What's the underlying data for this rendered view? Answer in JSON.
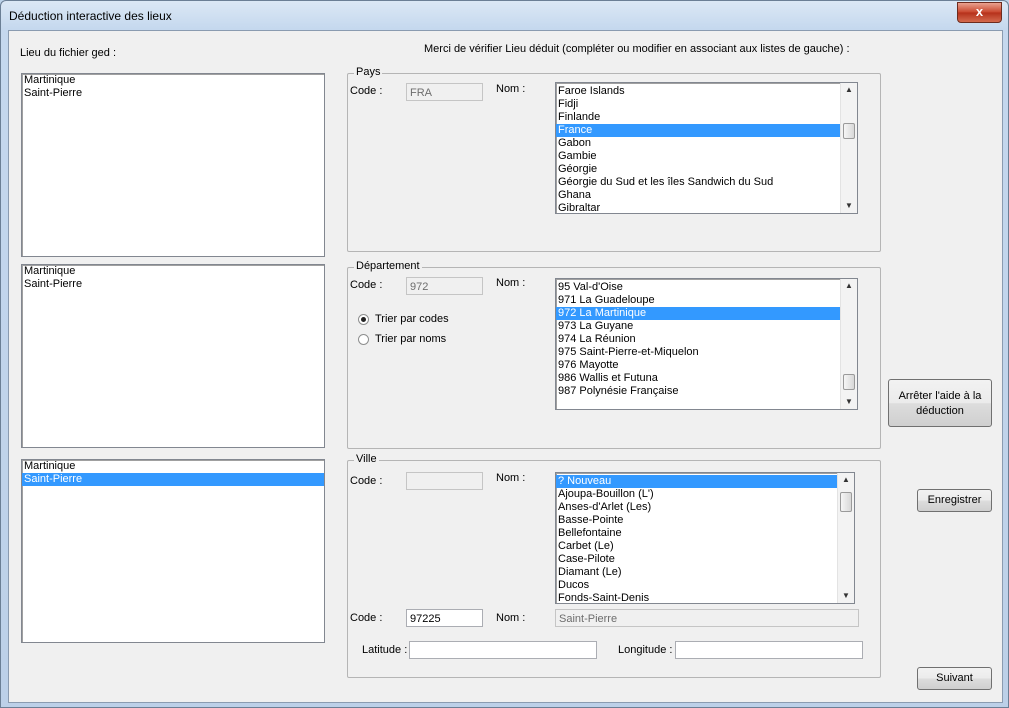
{
  "window": {
    "title": "Déduction interactive des lieux",
    "close_glyph": "x"
  },
  "left": {
    "heading": "Lieu du fichier ged :",
    "lists": [
      [
        "Martinique",
        "Saint-Pierre"
      ],
      [
        "Martinique",
        "Saint-Pierre"
      ],
      [
        "Martinique",
        "Saint-Pierre"
      ]
    ],
    "selected_third": "Saint-Pierre"
  },
  "instructions": "Merci de vérifier Lieu déduit (compléter ou modifier en associant aux listes de gauche) :",
  "pays": {
    "title": "Pays",
    "code_label": "Code :",
    "code_value": "FRA",
    "nom_label": "Nom :",
    "items": [
      "Faroe Islands",
      "Fidji",
      "Finlande",
      "France",
      "Gabon",
      "Gambie",
      "Géorgie",
      "Géorgie du Sud et les îles Sandwich du Sud",
      "Ghana",
      "Gibraltar"
    ],
    "selected": "France"
  },
  "departement": {
    "title": "Département",
    "code_label": "Code :",
    "code_value": "972",
    "nom_label": "Nom :",
    "radio_codes": "Trier par codes",
    "radio_noms": "Trier par noms",
    "sort_selected": "codes",
    "items": [
      "95 Val-d'Oise",
      "971 La Guadeloupe",
      "972 La Martinique",
      "973 La Guyane",
      "974 La Réunion",
      "975 Saint-Pierre-et-Miquelon",
      "976 Mayotte",
      "986 Wallis et Futuna",
      "987 Polynésie Française"
    ],
    "selected": "972 La Martinique"
  },
  "ville": {
    "title": "Ville",
    "code_label": "Code :",
    "code_value_top": "",
    "nom_label": "Nom :",
    "items": [
      "? Nouveau",
      "Ajoupa-Bouillon (L')",
      "Anses-d'Arlet (Les)",
      "Basse-Pointe",
      "Bellefontaine",
      "Carbet (Le)",
      "Case-Pilote",
      "Diamant (Le)",
      "Ducos",
      "Fonds-Saint-Denis"
    ],
    "selected": "? Nouveau",
    "code_label2": "Code :",
    "code_value": "97225",
    "nom_label2": "Nom :",
    "nom_value": "Saint-Pierre",
    "latitude_label": "Latitude :",
    "latitude_value": "",
    "longitude_label": "Longitude :",
    "longitude_value": ""
  },
  "buttons": {
    "stop_help": "Arrêter l'aide à la déduction",
    "save": "Enregistrer",
    "next": "Suivant"
  }
}
